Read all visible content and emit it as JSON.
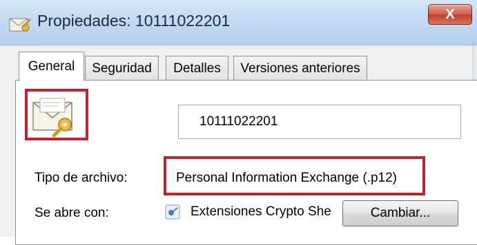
{
  "window": {
    "title": "Propiedades: 10111022201",
    "close_label": "X",
    "icons": {
      "title": "envelope-key-icon",
      "close": "close-icon"
    }
  },
  "tabs": [
    {
      "label": "General",
      "active": true
    },
    {
      "label": "Seguridad",
      "active": false
    },
    {
      "label": "Detalles",
      "active": false
    },
    {
      "label": "Versiones anteriores",
      "active": false
    }
  ],
  "general": {
    "file_icon": "certificate-envelope-key-icon",
    "file_name": "10111022201",
    "file_type_label": "Tipo de archivo:",
    "file_type_value": "Personal Information Exchange (.p12)",
    "opens_with_label": "Se abre con:",
    "opens_with_icon": "crypto-shell-icon",
    "opens_with_value": "Extensiones Crypto She",
    "change_button": "Cambiar..."
  },
  "highlight_color": "#c8202e"
}
